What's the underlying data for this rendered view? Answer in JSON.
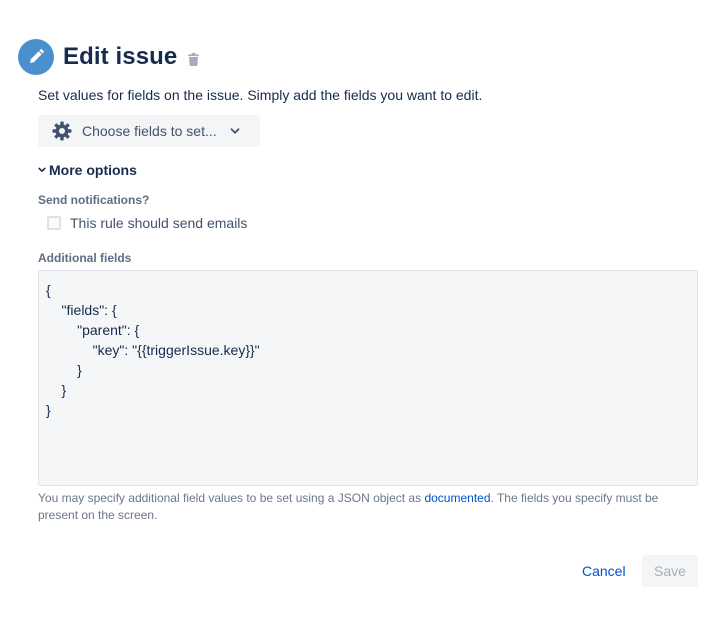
{
  "header": {
    "title": "Edit issue",
    "icon": "pencil-icon",
    "icon_color": "#4a90cf"
  },
  "description": "Set values for fields on the issue. Simply add the fields you want to edit.",
  "choose_fields": {
    "label": "Choose fields to set...",
    "icon": "gear-icon"
  },
  "more_options": {
    "label": "More options",
    "expanded": true
  },
  "notifications": {
    "label": "Send notifications?",
    "checkbox_label": "This rule should send emails",
    "checked": false
  },
  "additional_fields": {
    "label": "Additional fields",
    "lines": [
      "{",
      "    \"fields\": {",
      "        \"parent\": {",
      "            \"key\": \"{{triggerIssue.key}}\"",
      "        }",
      "    }",
      "}"
    ],
    "helper_before": "You may specify additional field values to be set using a JSON object as ",
    "helper_link": "documented",
    "helper_after": ". The fields you specify must be present on the screen."
  },
  "actions": {
    "cancel_label": "Cancel",
    "save_label": "Save"
  },
  "colors": {
    "link": "#0052cc",
    "text": "#172b4d",
    "subtle": "#6b778c"
  }
}
